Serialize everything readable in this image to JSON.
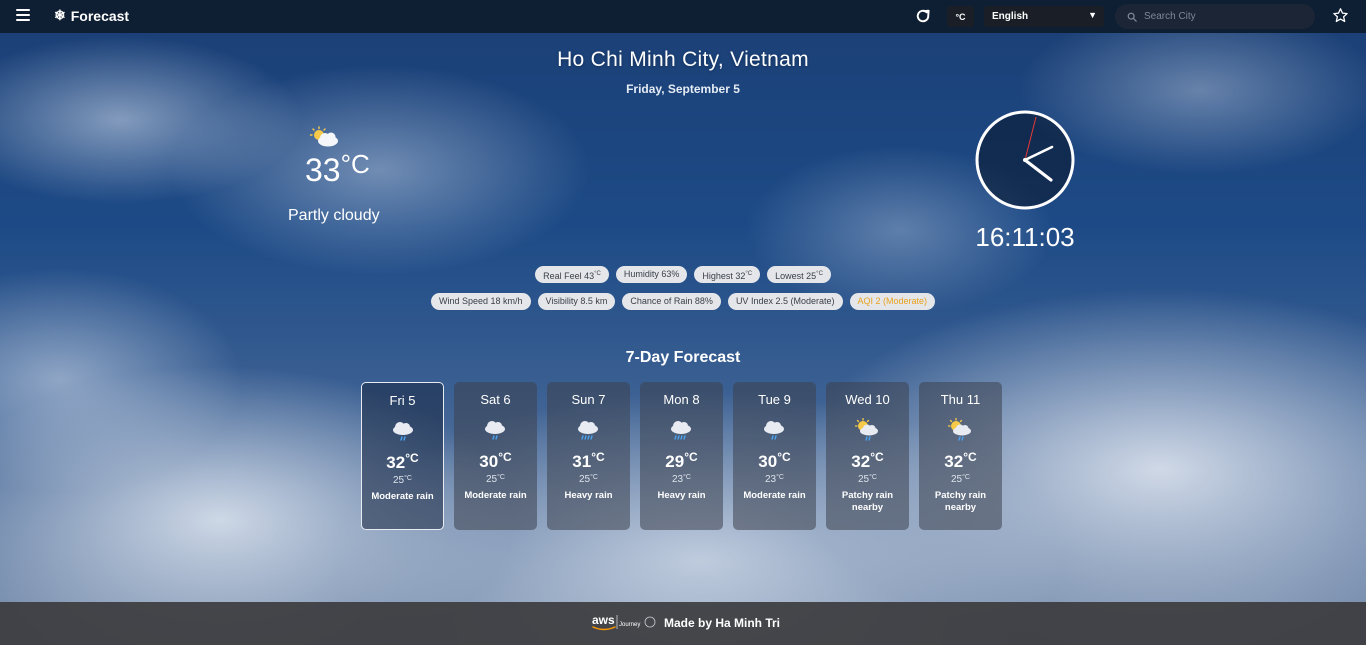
{
  "app": {
    "title": "Forecast",
    "unit_label": "°C",
    "language": "English",
    "search_placeholder": "Search City"
  },
  "location": {
    "name": "Ho Chi Minh City, Vietnam",
    "date": "Friday, September 5"
  },
  "current": {
    "temp": "33",
    "unit": "°C",
    "condition": "Partly cloudy",
    "icon": "partly-cloudy-icon"
  },
  "clock": {
    "time": "16:11:03"
  },
  "details_row1": [
    {
      "label": "Real Feel 43",
      "unit": "°C"
    },
    {
      "label": "Humidity 63%",
      "unit": ""
    },
    {
      "label": "Highest 32",
      "unit": "°C"
    },
    {
      "label": "Lowest 25",
      "unit": "°C"
    }
  ],
  "details_row2": [
    {
      "label": "Wind Speed 18 km/h"
    },
    {
      "label": "Visibility 8.5 km"
    },
    {
      "label": "Chance of Rain 88%"
    },
    {
      "label": "UV Index 2.5 (Moderate)"
    },
    {
      "label": "AQI 2 (Moderate)"
    }
  ],
  "colors": {
    "aqi": "#e8a21d",
    "topbar": "#0f1f33"
  },
  "forecast": {
    "title": "7-Day Forecast",
    "days": [
      {
        "name": "Fri 5",
        "hi": "32",
        "lo": "25",
        "unit": "°C",
        "cond": "Moderate rain",
        "icon": "rain-cloud-icon"
      },
      {
        "name": "Sat 6",
        "hi": "30",
        "lo": "25",
        "unit": "°C",
        "cond": "Moderate rain",
        "icon": "rain-cloud-icon"
      },
      {
        "name": "Sun 7",
        "hi": "31",
        "lo": "25",
        "unit": "°C",
        "cond": "Heavy rain",
        "icon": "heavy-rain-icon"
      },
      {
        "name": "Mon 8",
        "hi": "29",
        "lo": "23",
        "unit": "°C",
        "cond": "Heavy rain",
        "icon": "heavy-rain-icon"
      },
      {
        "name": "Tue 9",
        "hi": "30",
        "lo": "23",
        "unit": "°C",
        "cond": "Moderate rain",
        "icon": "rain-cloud-icon"
      },
      {
        "name": "Wed 10",
        "hi": "32",
        "lo": "25",
        "unit": "°C",
        "cond": "Patchy rain nearby",
        "icon": "sun-rain-icon"
      },
      {
        "name": "Thu 11",
        "hi": "32",
        "lo": "25",
        "unit": "°C",
        "cond": "Patchy rain nearby",
        "icon": "sun-rain-icon"
      }
    ]
  },
  "footer": {
    "logo_text": "aws",
    "logo_sub": "Journey",
    "made_by": "Made by Ha Minh Tri"
  }
}
